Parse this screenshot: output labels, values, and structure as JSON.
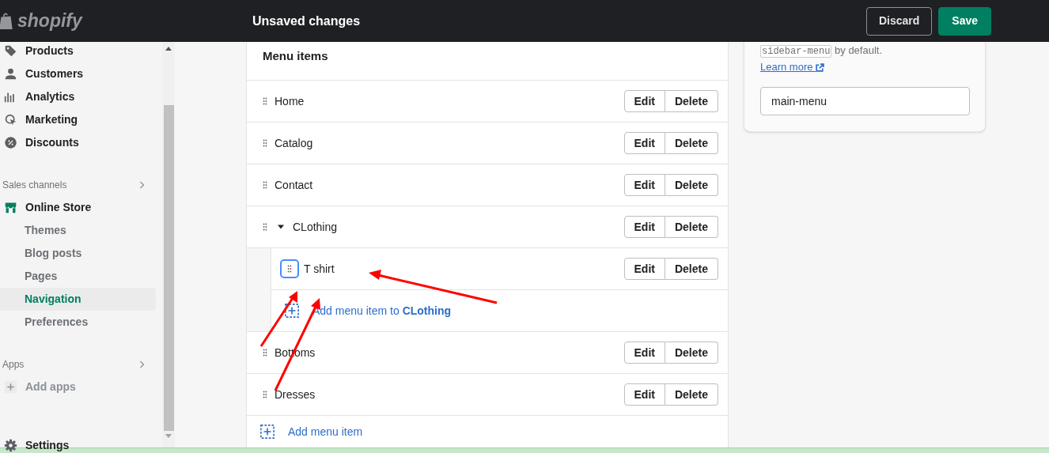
{
  "top_bar": {
    "logo": "shopify",
    "title": "Unsaved changes",
    "buttons": [
      {
        "label": "Discard",
        "kind": "secondary"
      },
      {
        "label": "Save",
        "kind": "primary"
      }
    ]
  },
  "sidebar": {
    "sections": [
      {
        "items": [
          {
            "label": "Products",
            "selected": false
          },
          {
            "label": "Customers",
            "selected": false
          },
          {
            "label": "Analytics",
            "selected": false
          },
          {
            "label": "Marketing",
            "selected": false
          },
          {
            "label": "Discounts",
            "selected": false
          }
        ]
      },
      {
        "heading": "Sales channels",
        "items": [
          {
            "label": "Online Store",
            "selected": false,
            "children": [
              {
                "label": "Themes",
                "selected": false
              },
              {
                "label": "Blog posts",
                "selected": false
              },
              {
                "label": "Pages",
                "selected": false
              },
              {
                "label": "Navigation",
                "selected": true
              },
              {
                "label": "Preferences",
                "selected": false
              }
            ]
          }
        ]
      },
      {
        "heading": "Apps",
        "items": [
          {
            "label": "Add apps",
            "selected": false,
            "kind": "add"
          }
        ]
      },
      {
        "items": [
          {
            "label": "Settings",
            "selected": false
          }
        ]
      }
    ]
  },
  "menu_card": {
    "title": "Menu items",
    "items": [
      {
        "label": "Home",
        "expanded": false,
        "focused": false,
        "actions": [
          "Edit",
          "Delete"
        ]
      },
      {
        "label": "Catalog",
        "expanded": false,
        "focused": false,
        "actions": [
          "Edit",
          "Delete"
        ]
      },
      {
        "label": "Contact",
        "expanded": false,
        "focused": false,
        "actions": [
          "Edit",
          "Delete"
        ]
      },
      {
        "label": "CLothing",
        "expanded": true,
        "focused": false,
        "actions": [
          "Edit",
          "Delete"
        ],
        "children": [
          {
            "label": "T shirt",
            "expanded": false,
            "focused": true,
            "actions": [
              "Edit",
              "Delete"
            ]
          }
        ],
        "add_child": "Add menu item to **CLothing**"
      },
      {
        "label": "Bottoms",
        "expanded": false,
        "focused": false,
        "actions": [
          "Edit",
          "Delete"
        ]
      },
      {
        "label": "Dresses",
        "expanded": false,
        "focused": false,
        "actions": [
          "Edit",
          "Delete"
        ]
      }
    ],
    "add_item": "Add menu item"
  },
  "handle_card": {
    "code": "sidebar-menu",
    "text": "by default.",
    "link": "Learn more",
    "value": "main-menu"
  }
}
